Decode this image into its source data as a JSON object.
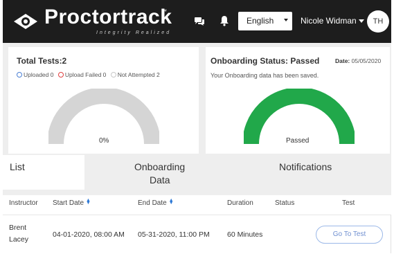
{
  "header": {
    "logo_text": "Proctortrack",
    "logo_tm": "™",
    "logo_tagline": "Integrity Realized",
    "language": {
      "selected": "English"
    },
    "user_name": "Nicole Widman",
    "avatar_initials": "TH",
    "icons": [
      "eye-logo-icon",
      "chat-icon",
      "bell-icon",
      "caret-down-icon"
    ]
  },
  "tests_card": {
    "title": "Total Tests:2",
    "legend": [
      {
        "label": "Uploaded 0",
        "color": "#4a7fd4"
      },
      {
        "label": "Upload Failed 0",
        "color": "#e04040"
      },
      {
        "label": "Not Attempted 2",
        "color": "#c8c8c8"
      }
    ],
    "gauge_percent_label": "0%",
    "gauge_fill": 0,
    "gauge_color": "#d5d5d5"
  },
  "onboarding_card": {
    "title": "Onboarding Status: Passed",
    "date_label": "Date:",
    "date_value": "05/05/2020",
    "message": "Your Onboarding data has been saved.",
    "gauge_label": "Passed",
    "gauge_fill": 1,
    "gauge_color": "#21a84a"
  },
  "tabs": {
    "list": "List",
    "onboarding_line1": "Onboarding",
    "onboarding_line2": "Data",
    "notifications": "Notifications"
  },
  "table": {
    "headers": {
      "instructor": "Instructor",
      "start_date": "Start Date",
      "end_date": "End Date",
      "duration": "Duration",
      "status": "Status",
      "test": "Test"
    },
    "sort_icon": "sort-arrows-icon",
    "rows": [
      {
        "instructor_first": "Brent",
        "instructor_last": "Lacey",
        "start_date": "04-01-2020, 08:00 AM",
        "end_date": "05-31-2020, 11:00 PM",
        "duration": "60 Minutes",
        "status": "",
        "test_button": "Go To Test"
      }
    ]
  },
  "colors": {
    "header_bg": "#1d1d1d",
    "passed_green": "#21a84a",
    "link_blue": "#2f7ad6"
  }
}
